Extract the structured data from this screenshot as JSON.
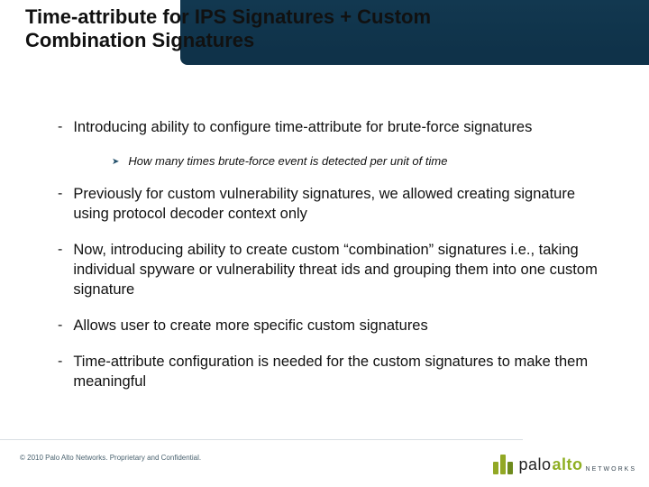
{
  "title": "Time-attribute for IPS Signatures + Custom Combination Signatures",
  "bullets": [
    {
      "text": "Introducing ability to configure time-attribute for brute-force signatures",
      "sub": [
        "How many times brute-force event is detected per unit of time"
      ]
    },
    {
      "text": "Previously for custom vulnerability signatures, we allowed creating signature using protocol decoder context only"
    },
    {
      "text": "Now, introducing ability to create custom “combination” signatures i.e., taking individual spyware or vulnerability threat ids and grouping them into one custom signature"
    },
    {
      "text": "Allows user to create more specific custom signatures"
    },
    {
      "text": "Time-attribute configuration is needed for the custom signatures to make them meaningful"
    }
  ],
  "footer": "© 2010 Palo Alto Networks. Proprietary and Confidential.",
  "logo": {
    "word1": "palo",
    "word2": "alto",
    "sub": "NETWORKS"
  }
}
